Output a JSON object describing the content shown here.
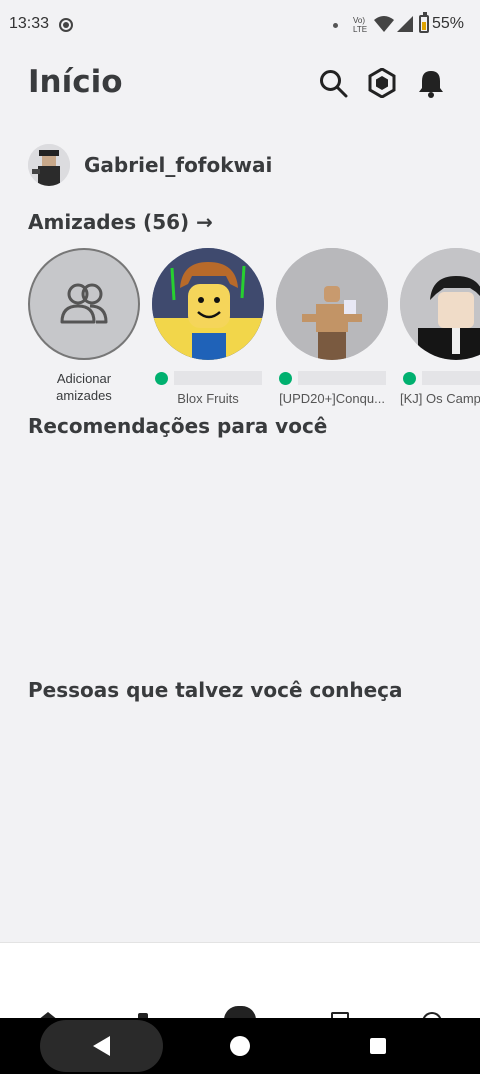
{
  "status_bar": {
    "time": "13:33",
    "network": "Vo) LTE",
    "battery": "55%",
    "battery_level": 0.55
  },
  "header": {
    "title": "Início",
    "icons": [
      "search-icon",
      "robux-icon",
      "notifications-icon"
    ]
  },
  "profile": {
    "username": "Gabriel_fofokwai"
  },
  "friends": {
    "title": "Amizades (56) →",
    "add_label_line1": "Adicionar",
    "add_label_line2": "amizades",
    "items": [
      {
        "game": "Blox Fruits",
        "online": true
      },
      {
        "game": "[UPD20+]Conqu...",
        "online": true
      },
      {
        "game": "[KJ] Os Camp",
        "online": true
      }
    ]
  },
  "sections": {
    "recommendations": "Recomendações para você",
    "people": "Pessoas que talvez você conheça"
  },
  "colors": {
    "background": "#f2f2f4",
    "text": "#393b3d",
    "online": "#00b06f"
  }
}
